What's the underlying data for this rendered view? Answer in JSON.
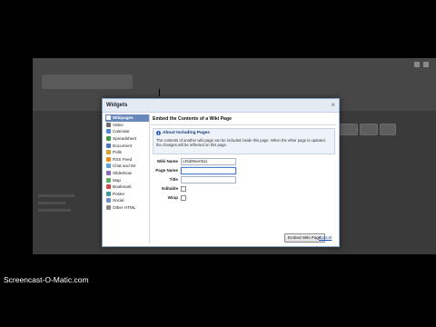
{
  "dialog": {
    "title": "Widgets",
    "close_glyph": "×",
    "sidebar": [
      {
        "label": "Wikipages",
        "icon": "wiki-page-icon",
        "color": "#ffffff",
        "active": true
      },
      {
        "label": "Video",
        "icon": "video-icon",
        "color": "#6b6b6b"
      },
      {
        "label": "Calendar",
        "icon": "calendar-icon",
        "color": "#4f86d6"
      },
      {
        "label": "Spreadsheet",
        "icon": "spreadsheet-icon",
        "color": "#3b9b4a"
      },
      {
        "label": "Document",
        "icon": "document-icon",
        "color": "#4a78c8"
      },
      {
        "label": "Polls",
        "icon": "poll-icon",
        "color": "#d6a236"
      },
      {
        "label": "RSS Feed",
        "icon": "rss-icon",
        "color": "#f28a1a"
      },
      {
        "label": "Chat and IM",
        "icon": "chat-icon",
        "color": "#58a0d8"
      },
      {
        "label": "Slideshow",
        "icon": "slideshow-icon",
        "color": "#8a6bbf"
      },
      {
        "label": "Map",
        "icon": "map-icon",
        "color": "#5bae5b"
      },
      {
        "label": "Bookmark",
        "icon": "bookmark-icon",
        "color": "#c94b4b"
      },
      {
        "label": "Poster",
        "icon": "poster-icon",
        "color": "#3f9a9a"
      },
      {
        "label": "Social",
        "icon": "social-icon",
        "color": "#6d8fcf"
      },
      {
        "label": "Other HTML",
        "icon": "html-icon",
        "color": "#888888"
      }
    ],
    "main": {
      "title": "Embed the Contents of a Wiki Page",
      "info_title": "About Including Pages",
      "info_icon_glyph": "i",
      "info_text": "The contents of another wiki page can be included inside this page. When the other page is updated, the changes will be reflected on this page.",
      "fields": {
        "wiki_name_label": "Wiki Name",
        "wiki_name_value": "c45d08ee0511",
        "page_name_label": "Page Name",
        "page_name_value": "",
        "title_label": "Title",
        "title_value": "",
        "editable_label": "Editable",
        "editable_checked": false,
        "wrap_label": "Wrap",
        "wrap_checked": false
      },
      "embed_button": "Embed Wiki Page",
      "cancel_link": "Cancel"
    }
  },
  "watermark": "Screencast-O-Matic.com"
}
